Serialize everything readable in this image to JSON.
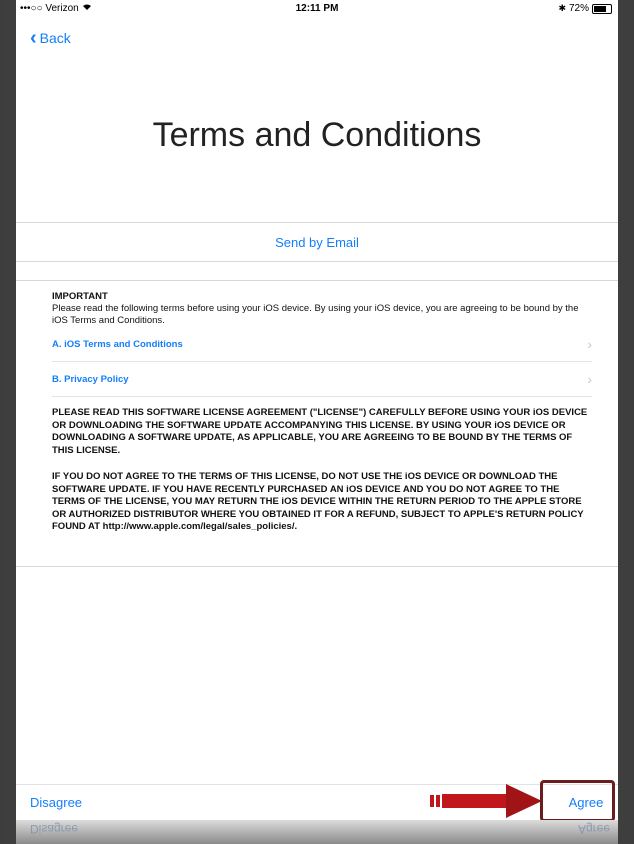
{
  "status_bar": {
    "carrier": "•••○○ Verizon",
    "wifi_icon": "wifi-icon",
    "time": "12:11 PM",
    "bluetooth_icon": "bluetooth-icon",
    "battery_percent": "72%",
    "battery_level": 0.72
  },
  "nav": {
    "back_label": "Back"
  },
  "title": "Terms and Conditions",
  "email_button": "Send by Email",
  "terms": {
    "important_heading": "IMPORTANT",
    "important_text": "Please read the following terms before using your iOS device. By using your iOS device, you are agreeing to be bound by the iOS Terms and Conditions.",
    "links": [
      {
        "label": "A. iOS Terms and Conditions"
      },
      {
        "label": "B. Privacy Policy"
      }
    ],
    "paragraph_1": "PLEASE READ THIS SOFTWARE LICENSE AGREEMENT (\"LICENSE\") CAREFULLY BEFORE USING YOUR iOS DEVICE OR DOWNLOADING THE SOFTWARE UPDATE ACCOMPANYING THIS LICENSE. BY USING YOUR iOS DEVICE OR DOWNLOADING A SOFTWARE UPDATE, AS APPLICABLE, YOU ARE AGREEING TO BE BOUND BY THE TERMS OF THIS LICENSE.",
    "paragraph_2": "IF YOU DO NOT AGREE TO THE TERMS OF THIS LICENSE, DO NOT USE THE iOS DEVICE OR DOWNLOAD THE SOFTWARE UPDATE. IF YOU HAVE RECENTLY PURCHASED AN iOS DEVICE AND YOU DO NOT AGREE TO THE TERMS OF THE LICENSE, YOU MAY RETURN THE iOS DEVICE WITHIN THE RETURN PERIOD TO THE APPLE STORE OR AUTHORIZED DISTRIBUTOR WHERE YOU OBTAINED IT FOR A REFUND, SUBJECT TO APPLE'S RETURN POLICY FOUND AT http://www.apple.com/legal/sales_policies/."
  },
  "bottom": {
    "disagree_label": "Disagree",
    "agree_label": "Agree"
  },
  "colors": {
    "link_blue": "#147efb",
    "highlight_border": "#6b1d1d",
    "arrow_red": "#c0161c"
  }
}
